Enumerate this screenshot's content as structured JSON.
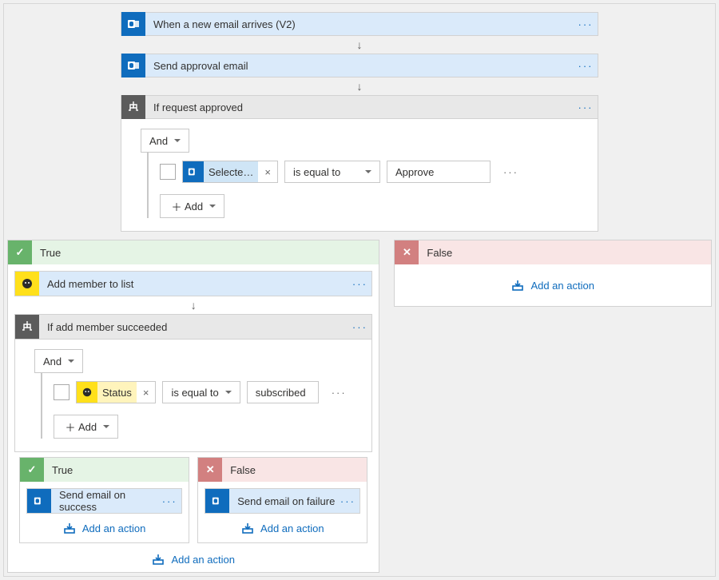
{
  "steps": {
    "trigger": {
      "title": "When a new email arrives (V2)"
    },
    "approval": {
      "title": "Send approval email"
    },
    "cond1": {
      "title": "If request approved",
      "group": "And",
      "row": {
        "token": "Selecte…",
        "operator": "is equal to",
        "value": "Approve"
      },
      "add": "Add"
    },
    "true_branch": {
      "label": "True"
    },
    "false_branch": {
      "label": "False"
    },
    "add_member": {
      "title": "Add member to list"
    },
    "cond2": {
      "title": "If add member succeeded",
      "group": "And",
      "row": {
        "token": "Status",
        "operator": "is equal to",
        "value": "subscribed"
      },
      "add": "Add"
    },
    "nested_true": {
      "label": "True"
    },
    "nested_false": {
      "label": "False"
    },
    "send_success": {
      "title": "Send email on success"
    },
    "send_failure": {
      "title": "Send email on failure"
    },
    "add_action": "Add an action"
  }
}
